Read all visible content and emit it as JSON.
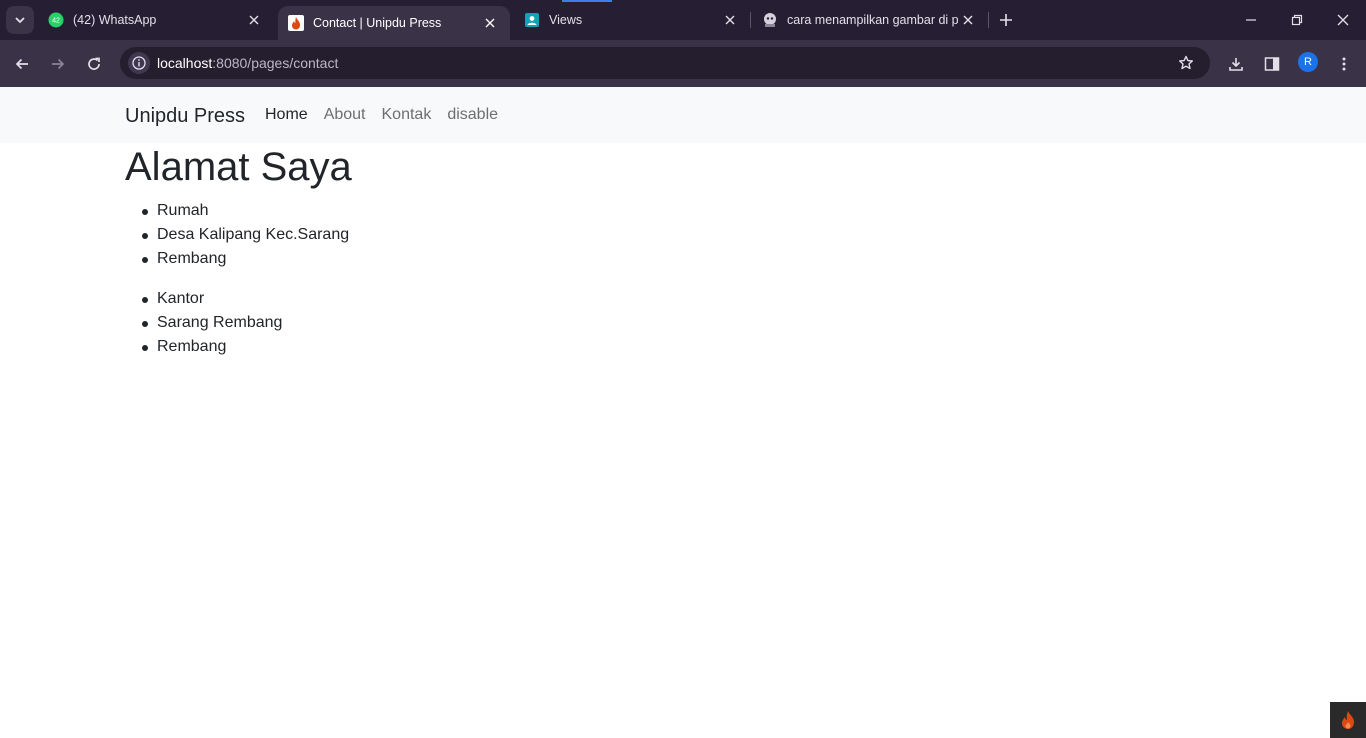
{
  "browser": {
    "tabs": [
      {
        "title": "(42) WhatsApp",
        "badge": "42",
        "icon": "whatsapp-icon"
      },
      {
        "title": "Contact | Unipdu Press",
        "icon": "codeigniter-flame-icon",
        "active": true
      },
      {
        "title": "Views",
        "icon": "contact-card-icon"
      },
      {
        "title": "cara menampilkan gambar di pl",
        "icon": "ghost-avatar-icon"
      }
    ],
    "url": {
      "host": "localhost",
      "path": ":8080/pages/contact"
    },
    "profile_initial": "R",
    "colors": {
      "tabstrip": "#261f33",
      "toolbar": "#3a3247",
      "omnibox": "#241e2e",
      "accent": "#1a73e8"
    }
  },
  "navbar": {
    "brand": "Unipdu Press",
    "links": [
      {
        "label": "Home",
        "active": true
      },
      {
        "label": "About"
      },
      {
        "label": "Kontak"
      },
      {
        "label": "disable"
      }
    ]
  },
  "content": {
    "heading": "Alamat Saya",
    "home_list": [
      "Rumah",
      "Desa Kalipang Kec.Sarang",
      "Rembang"
    ],
    "office_list": [
      "Kantor",
      "Sarang Rembang",
      "Rembang"
    ]
  }
}
